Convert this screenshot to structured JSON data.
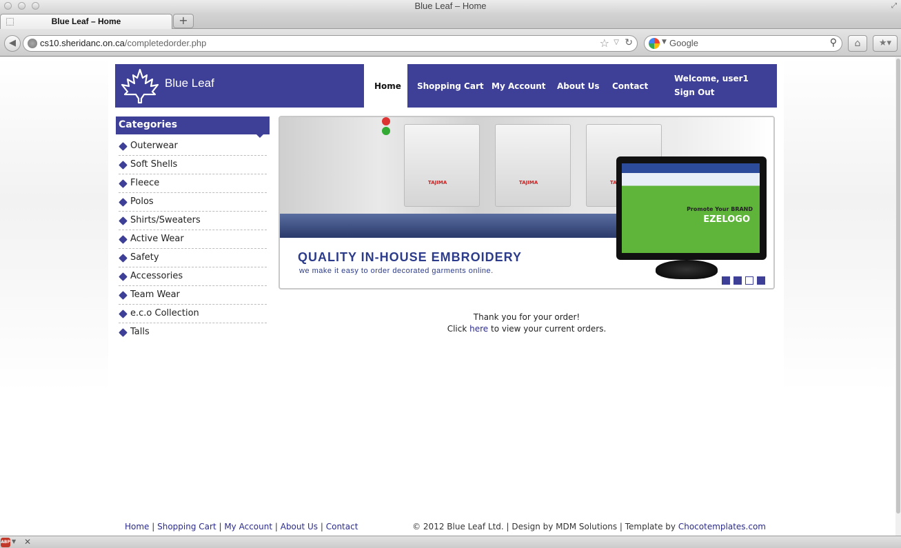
{
  "window": {
    "title": "Blue Leaf – Home"
  },
  "tabs": [
    {
      "label": "Blue Leaf – Home"
    }
  ],
  "toolbar": {
    "new_tab_label": "+",
    "url_host": "cs10.sheridanc.on.ca",
    "url_path": "/completedorder.php",
    "search_placeholder": "Google"
  },
  "site": {
    "title": "Blue Leaf",
    "nav": [
      "Home",
      "Shopping Cart",
      "My Account",
      "About Us",
      "Contact"
    ],
    "welcome": "Welcome, user1",
    "signout": "Sign Out"
  },
  "categories": {
    "heading": "Categories",
    "items": [
      "Outerwear",
      "Soft Shells",
      "Fleece",
      "Polos",
      "Shirts/Sweaters",
      "Active Wear",
      "Safety",
      "Accessories",
      "Team Wear",
      "e.c.o Collection",
      "Talls"
    ]
  },
  "banner": {
    "headline": "QUALITY IN-HOUSE EMBROIDERY",
    "subline": "we make it easy to order decorated garments online.",
    "machine_label": "TAJIMA",
    "monitor_brand": "Promote Your BRAND",
    "monitor_logo": "EZELOGO",
    "active_slide": 3,
    "slide_count": 4
  },
  "message": {
    "thanks": "Thank you for your order!",
    "click": "Click",
    "link": "here",
    "rest": "to view your current orders."
  },
  "footer": {
    "links": [
      "Home",
      "Shopping Cart",
      "My Account",
      "About Us",
      "Contact"
    ],
    "copyright": "© 2012 Blue Leaf Ltd. | Design by MDM Solutions | Template by",
    "template_link": "Chocotemplates.com"
  },
  "colors": {
    "brand": "#3e3f96",
    "link": "#2a2a8a"
  }
}
